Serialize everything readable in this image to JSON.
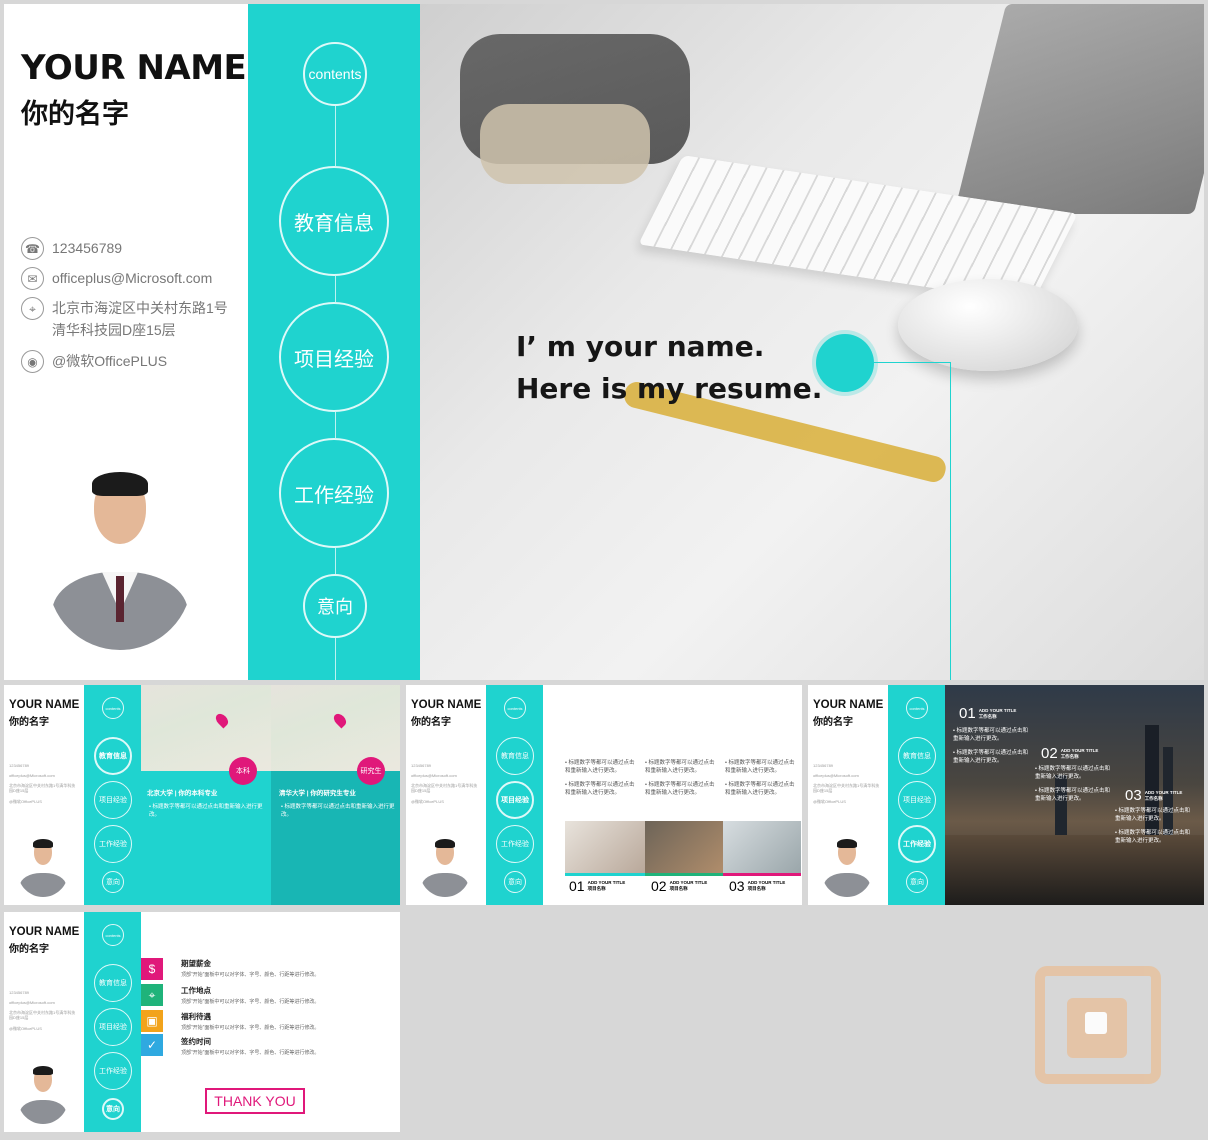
{
  "profile": {
    "name_en": "YOUR NAME",
    "name_cn": "你的名字",
    "phone": "123456789",
    "email": "officeplus@Microsoft.com",
    "address": "北京市海淀区中关村东路1号清华科技园D座15层",
    "weibo": "@微软OfficePLUS"
  },
  "nav": {
    "contents": "contents",
    "education": "教育信息",
    "projects": "项目经验",
    "work": "工作经验",
    "intention": "意向"
  },
  "hero": {
    "line1": "I’ m your name.",
    "line2": "Here is my resume."
  },
  "edu": {
    "col1_title": "北京大学 | 你的本科专业",
    "col1_tag": "本科",
    "col2_title": "清华大学 | 你的研究生专业",
    "col2_tag": "研究生",
    "body": "• 标题数字等都可以通过点击和重新输入进行更改。"
  },
  "projects": {
    "bullet": "• 标题数字等都可以通过点击和重新输入进行更改。",
    "items": [
      {
        "num": "01",
        "sub": "ADD YOUR TITLE",
        "name": "项目名称"
      },
      {
        "num": "02",
        "sub": "ADD YOUR TITLE",
        "name": "项目名称"
      },
      {
        "num": "03",
        "sub": "ADD YOUR TITLE",
        "name": "项目名称"
      }
    ]
  },
  "work": {
    "items": [
      {
        "num": "01",
        "sub": "ADD YOUR TITLE",
        "name": "工作名称"
      },
      {
        "num": "02",
        "sub": "ADD YOUR TITLE",
        "name": "工作名称"
      },
      {
        "num": "03",
        "sub": "ADD YOUR TITLE",
        "name": "工作名称"
      }
    ],
    "bullet": "• 标题数字等都可以通过点击和重新输入进行更改。"
  },
  "intent": {
    "items": [
      {
        "title": "期望薪金",
        "desc": "顶部“开始”面板中可以对字体、字号、颜色、行距等进行修改。",
        "icon": "dollar-icon",
        "color": "#e0187a"
      },
      {
        "title": "工作地点",
        "desc": "顶部“开始”面板中可以对字体、字号、颜色、行距等进行修改。",
        "icon": "location-icon",
        "color": "#1fb37a"
      },
      {
        "title": "福利待遇",
        "desc": "顶部“开始”面板中可以对字体、字号、颜色、行距等进行修改。",
        "icon": "gift-icon",
        "color": "#f2a31b"
      },
      {
        "title": "签约时间",
        "desc": "顶部“开始”面板中可以对字体、字号、颜色、行距等进行修改。",
        "icon": "check-icon",
        "color": "#2fa9e0"
      }
    ],
    "thank_you": "THANK YOU"
  },
  "colors": {
    "teal": "#1fd3cf",
    "magenta": "#e0187a"
  }
}
